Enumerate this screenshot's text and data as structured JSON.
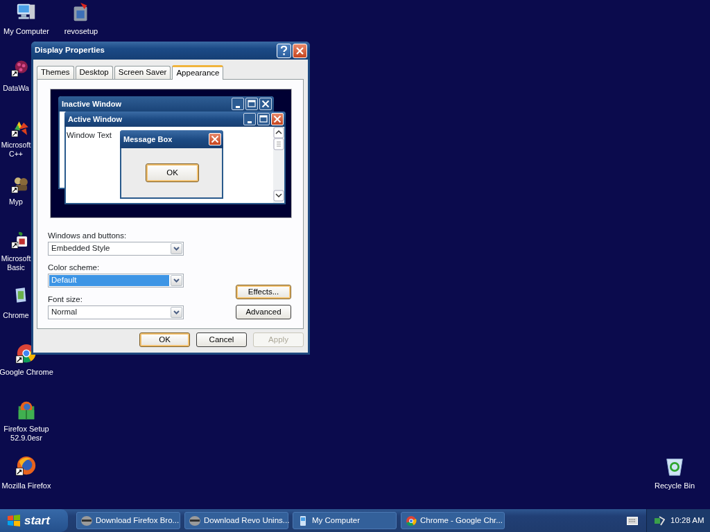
{
  "desktop_icons": [
    {
      "label": "My Computer",
      "kind": "computer",
      "shortcut": false
    },
    {
      "label": "revosetup",
      "kind": "installer",
      "shortcut": false
    },
    {
      "label": "DataWa",
      "kind": "flower",
      "shortcut": true
    },
    {
      "label": "Microsoft C++",
      "kind": "wedges",
      "shortcut": true
    },
    {
      "label": "Myp",
      "kind": "figures",
      "shortcut": true
    },
    {
      "label": "Microsoft Basic",
      "kind": "leaf",
      "shortcut": true
    },
    {
      "label": "Chrome",
      "kind": "package",
      "shortcut": false
    },
    {
      "label": "Google Chrome",
      "kind": "chrome",
      "shortcut": true
    },
    {
      "label": "Firefox Setup 52.9.0esr",
      "kind": "setup",
      "shortcut": false
    },
    {
      "label": "Mozilla Firefox",
      "kind": "firefox",
      "shortcut": true
    },
    {
      "label": "Recycle Bin",
      "kind": "recycle",
      "shortcut": false
    }
  ],
  "dialog": {
    "title": "Display Properties",
    "tabs": [
      {
        "label": "Themes",
        "selected": false
      },
      {
        "label": "Desktop",
        "selected": false
      },
      {
        "label": "Screen Saver",
        "selected": false
      },
      {
        "label": "Appearance",
        "selected": true
      }
    ],
    "preview": {
      "inactive_window": {
        "title": "Inactive Window"
      },
      "active_window": {
        "title": "Active Window",
        "text": "Window Text"
      },
      "message_box": {
        "title": "Message Box",
        "button": "OK"
      }
    },
    "fields": [
      {
        "label": "Windows and buttons:",
        "value": "Embedded Style",
        "highlighted": false
      },
      {
        "label": "Color scheme:",
        "value": "Default",
        "highlighted": true
      },
      {
        "label": "Font size:",
        "value": "Normal",
        "highlighted": false
      }
    ],
    "side_buttons": [
      {
        "label": "Effects...",
        "default": true
      },
      {
        "label": "Advanced",
        "default": false
      }
    ],
    "buttons": [
      {
        "label": "OK",
        "default": true,
        "disabled": false
      },
      {
        "label": "Cancel",
        "default": false,
        "disabled": false
      },
      {
        "label": "Apply",
        "default": false,
        "disabled": true
      }
    ]
  },
  "taskbar": {
    "start": "start",
    "tasks": [
      {
        "label": "Download Firefox Bro...",
        "kind": "raccoon"
      },
      {
        "label": "Download Revo Unins...",
        "kind": "raccoon"
      },
      {
        "label": "My Computer",
        "kind": "computer"
      },
      {
        "label": "Chrome - Google Chr...",
        "kind": "chrome"
      }
    ],
    "clock": "10:28 AM"
  }
}
